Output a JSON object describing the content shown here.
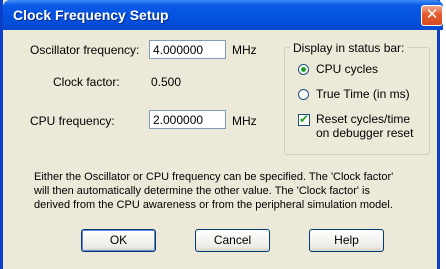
{
  "window": {
    "title": "Clock Frequency Setup",
    "close_glyph": "✕"
  },
  "form": {
    "oscillator_label": "Oscillator frequency:",
    "oscillator_value": "4.000000",
    "oscillator_unit": "MHz",
    "clock_factor_label": "Clock factor:",
    "clock_factor_value": "0.500",
    "cpu_label": "CPU frequency:",
    "cpu_value": "2.000000",
    "cpu_unit": "MHz"
  },
  "status_group": {
    "title": "Display in status bar:",
    "options": [
      {
        "label": "CPU cycles",
        "selected": true
      },
      {
        "label": "True Time (in ms)",
        "selected": false
      }
    ],
    "reset_checkbox": {
      "line1": "Reset cycles/time",
      "line2": "on debugger reset",
      "checked": true
    }
  },
  "note": {
    "line1": "Either the Oscillator or CPU frequency can be specified. The 'Clock factor'",
    "line2": "will then automatically determine the other value. The 'Clock factor' is",
    "line3": "derived from the CPU awareness or from the peripheral simulation model."
  },
  "buttons": {
    "ok": "OK",
    "cancel": "Cancel",
    "help": "Help"
  },
  "colors": {
    "title_bar": "#0351de",
    "dialog_bg": "#ece9d8",
    "close_button": "#e35b2e",
    "radio_dot": "#21a121"
  }
}
